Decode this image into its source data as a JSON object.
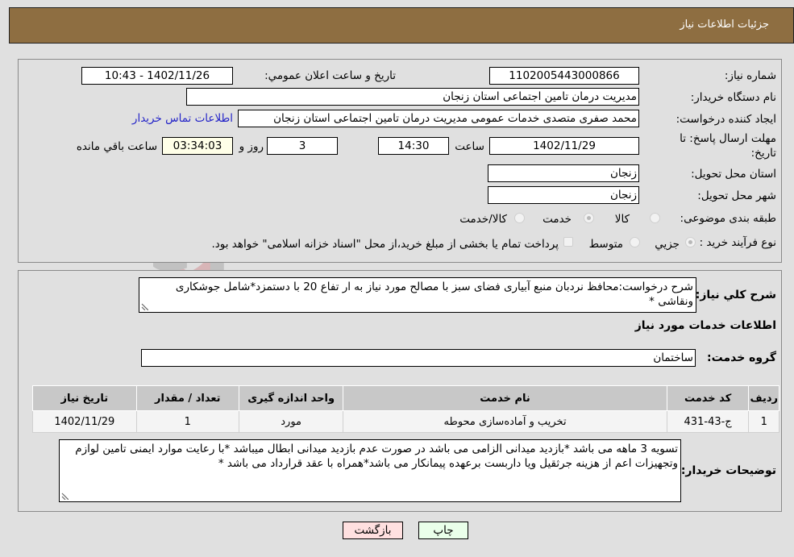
{
  "header": {
    "title": "جزئیات اطلاعات نیاز"
  },
  "form": {
    "need_number": {
      "label": "شماره نیاز:",
      "value": "1102005443000866"
    },
    "announce_datetime": {
      "label": "تاریخ و ساعت اعلان عمومي:",
      "value": "1402/11/26 - 10:43"
    },
    "buyer_org": {
      "label": "نام دستگاه خریدار:",
      "value": "مدیریت درمان تامین اجتماعی استان زنجان"
    },
    "requester": {
      "label": "ایجاد کننده درخواست:",
      "value": "محمد صفری متصدی خدمات عمومی مدیریت درمان تامین اجتماعی استان زنجان",
      "contact_link": "اطلاعات تماس خریدار"
    },
    "deadline": {
      "label_line1": "مهلت ارسال پاسخ: تا",
      "label_line2": "تاریخ:",
      "date": "1402/11/29",
      "time_label": "ساعت",
      "time": "14:30",
      "days": "3",
      "days_label": "روز و",
      "remaining": "03:34:03",
      "remaining_label": "ساعت باقي مانده"
    },
    "delivery_province": {
      "label": "استان محل تحویل:",
      "value": "زنجان"
    },
    "delivery_city": {
      "label": "شهر محل تحویل:",
      "value": "زنجان"
    },
    "category": {
      "label": "طبقه بندی موضوعی:",
      "options": [
        {
          "label": "کالا",
          "checked": false
        },
        {
          "label": "خدمت",
          "checked": true
        },
        {
          "label": "کالا/خدمت",
          "checked": false
        }
      ]
    },
    "purchase_type": {
      "label": "نوع فرآیند خرید :",
      "options": [
        {
          "label": "جزيي",
          "checked": true
        },
        {
          "label": "متوسط",
          "checked": false
        }
      ],
      "treasury_note": "پرداخت تمام یا بخشی از مبلغ خرید،از محل \"اسناد خزانه اسلامی\" خواهد بود."
    }
  },
  "description": {
    "label": "شرح کلي نياز:",
    "value": "شرح درخواست:محافظ نردبان منبع آبیاری فضای سبز با مصالح مورد نیاز به ار تفاع 20 با دستمزد*شامل جوشکاری ونقاشی *"
  },
  "services": {
    "section_title": "اطلاعات خدمات مورد نیاز",
    "group_label": "گروه خدمت:",
    "group_value": "ساختمان",
    "table": {
      "headers": [
        "ردیف",
        "کد خدمت",
        "نام خدمت",
        "واحد اندازه گیری",
        "تعداد / مقدار",
        "تاریخ نیاز"
      ],
      "rows": [
        [
          "1",
          "ج-43-431",
          "تخریب و آماده‌سازی محوطه",
          "مورد",
          "1",
          "1402/11/29"
        ]
      ]
    }
  },
  "buyer_notes": {
    "label": "توضیحات خریدار:",
    "value": "تسویه 3 ماهه می باشد *بازدید میدانی الزامی می باشد در صورت عدم بازدید میدانی ابطال میباشد *با رعایت موارد ایمنی تامین لوازم وتجهیزات اعم از هزینه جرثقیل ویا داربست برعهده پیمانکار می باشد*همراه با عقد قرارداد می باشد *"
  },
  "buttons": {
    "print": "چاپ",
    "back": "بازگشت"
  },
  "colors": {
    "header_bg": "#8e6e41",
    "link": "#2323c8",
    "print_bg": "#eaffea",
    "back_bg": "#ffe0e0",
    "remaining_bg": "#ffffe8"
  },
  "watermark": {
    "text": "AriaTender.neT"
  }
}
